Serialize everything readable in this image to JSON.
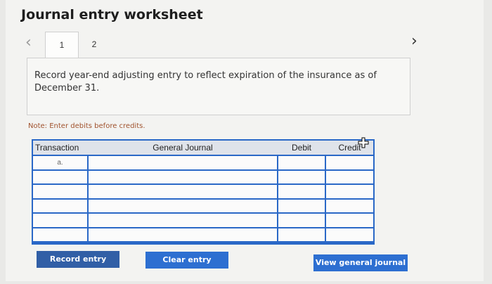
{
  "title": "Journal entry worksheet",
  "tabs": [
    {
      "label": "1"
    },
    {
      "label": "2"
    }
  ],
  "instruction": "Record year-end adjusting entry to reflect expiration of the insurance as of December 31.",
  "note": "Note: Enter debits before credits.",
  "table": {
    "headers": {
      "transaction": "Transaction",
      "general_journal": "General Journal",
      "debit": "Debit",
      "credit": "Credit"
    },
    "rows": [
      {
        "transaction": "a."
      },
      {
        "transaction": ""
      },
      {
        "transaction": ""
      },
      {
        "transaction": ""
      },
      {
        "transaction": ""
      },
      {
        "transaction": ""
      }
    ]
  },
  "buttons": {
    "record": "Record entry",
    "clear": "Clear entry",
    "view": "View general journal"
  },
  "icons": {
    "prev": "chevron-left-icon",
    "next": "chevron-right-icon",
    "cursor": "plus-cursor-icon"
  },
  "colors": {
    "button_blue": "#2d6fd1",
    "grid_blue": "#2a68c7",
    "note_text": "#a0522d"
  }
}
